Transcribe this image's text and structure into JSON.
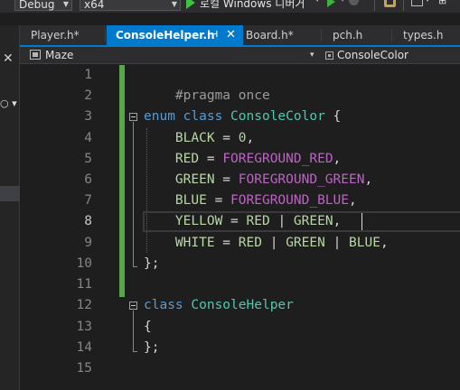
{
  "toolbar": {
    "config": "Debug",
    "platform": "x64",
    "run_label": "로컬 Windows 디버거"
  },
  "tabs": [
    {
      "label": "Player.h*",
      "active": false
    },
    {
      "label": "ConsoleHelper.h",
      "active": true
    },
    {
      "label": "Board.h*",
      "active": false
    },
    {
      "label": "pch.h",
      "active": false
    },
    {
      "label": "types.h",
      "active": false
    }
  ],
  "navbar": {
    "project": "Maze",
    "scope": "ConsoleColor"
  },
  "editor": {
    "current_line": 8,
    "line_numbers": [
      "1",
      "2",
      "3",
      "4",
      "5",
      "6",
      "7",
      "8",
      "9",
      "10",
      "11",
      "12",
      "13",
      "14",
      "15"
    ],
    "lines": {
      "l1_pragma": "#pragma once",
      "l3_enum": "enum",
      "l3_class": "class",
      "l3_name": "ConsoleColor",
      "l3_brace": "{",
      "l4_name": "BLACK",
      "l4_eq": " = ",
      "l4_val": "0",
      "l4_comma": ",",
      "l5_name": "RED",
      "l5_eq": " = ",
      "l5_val": "FOREGROUND_RED",
      "l5_comma": ",",
      "l6_name": "GREEN",
      "l6_eq": " = ",
      "l6_val": "FOREGROUND_GREEN",
      "l6_comma": ",",
      "l7_name": "BLUE",
      "l7_eq": " = ",
      "l7_val": "FOREGROUND_BLUE",
      "l7_comma": ",",
      "l8_name": "YELLOW",
      "l8_eq": " = ",
      "l8_a": "RED",
      "l8_op": " | ",
      "l8_b": "GREEN",
      "l8_comma": ",",
      "l9_name": "WHITE",
      "l9_eq": " = ",
      "l9_a": "RED",
      "l9_op1": " | ",
      "l9_b": "GREEN",
      "l9_op2": " | ",
      "l9_c": "BLUE",
      "l9_comma": ",",
      "l10_close": "};",
      "l12_class": "class",
      "l12_name": "ConsoleHelper",
      "l13_open": "{",
      "l14_close": "};"
    }
  },
  "colors": {
    "keyword": "#569cd6",
    "type": "#4ec9b0",
    "macro": "#bd63c5",
    "enum_member": "#b8d7a3",
    "accent": "#007acc",
    "change_bar": "#57a64a"
  }
}
